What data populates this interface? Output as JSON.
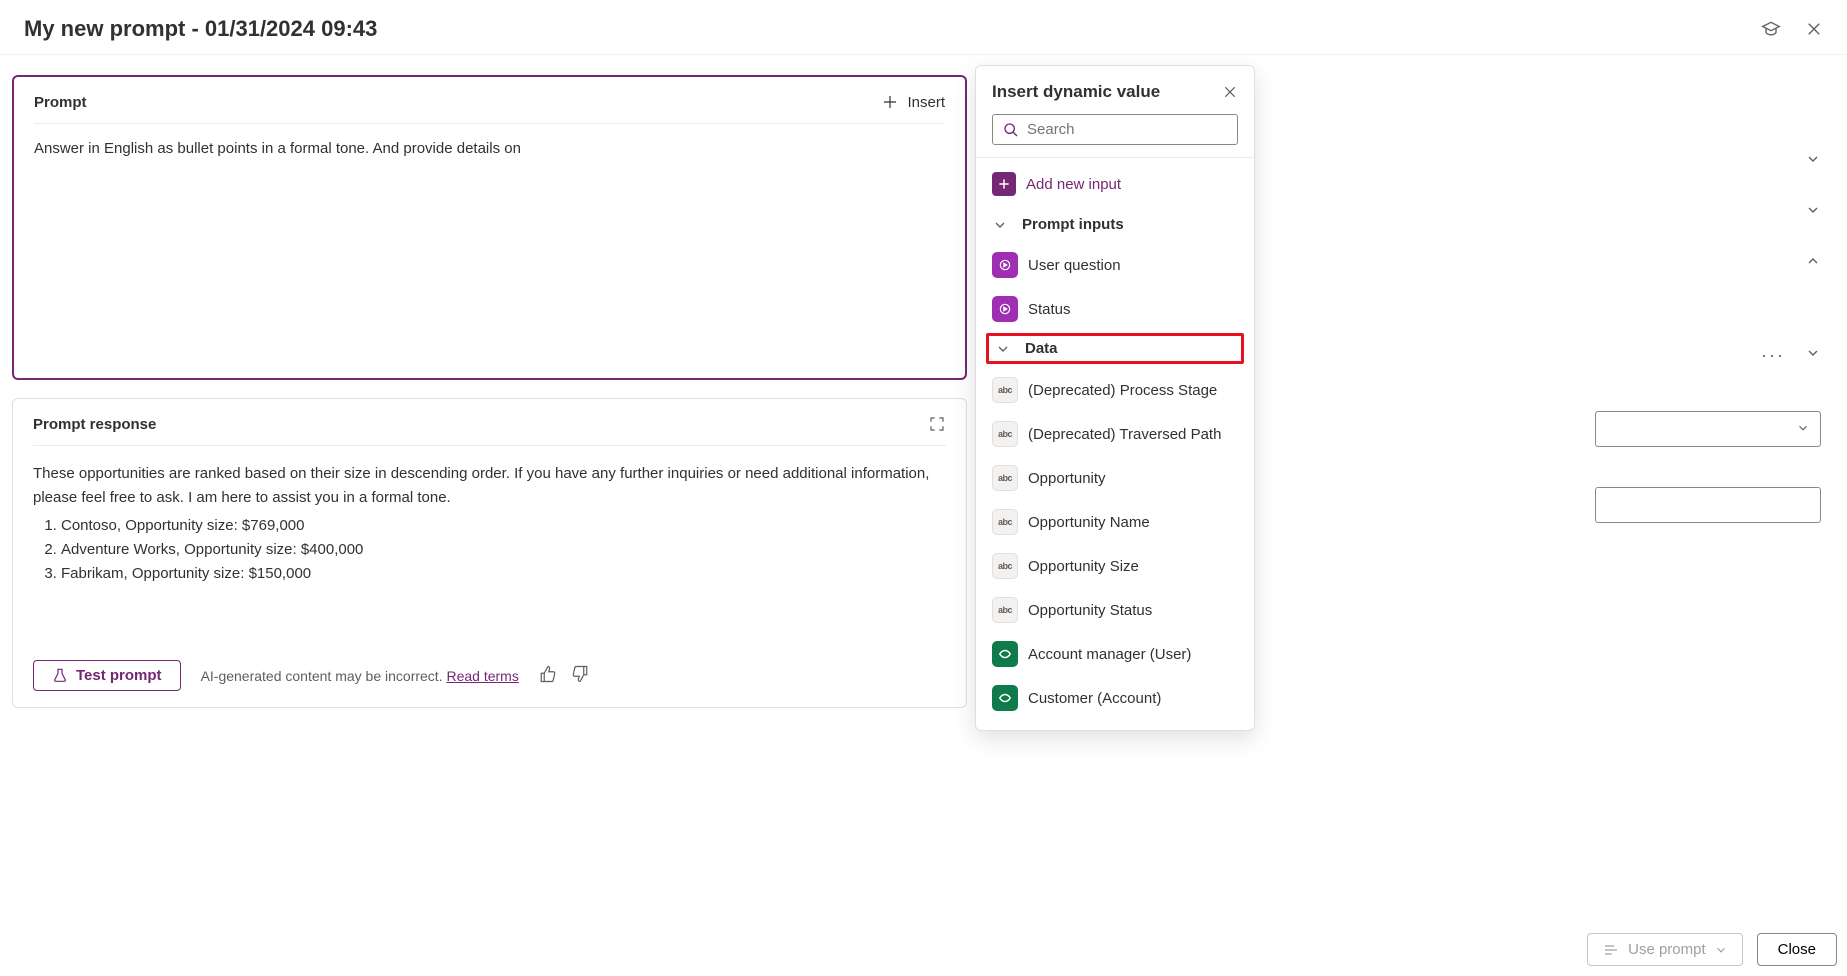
{
  "header": {
    "title": "My new prompt - 01/31/2024 09:43"
  },
  "prompt": {
    "section_label": "Prompt",
    "insert_label": "Insert",
    "text": "Answer in English as bullet points in a formal tone. And provide details on"
  },
  "response": {
    "section_label": "Prompt response",
    "intro": "These opportunities are ranked based on their size in descending order. If you have any further inquiries or need additional information, please feel free to ask. I am here to assist you in a formal tone.",
    "items": [
      "Contoso, Opportunity size: $769,000",
      "Adventure Works, Opportunity size: $400,000",
      "Fabrikam, Opportunity size: $150,000"
    ],
    "test_label": "Test prompt",
    "disclaimer": "AI-generated content may be incorrect.",
    "read_terms": "Read terms"
  },
  "flyout": {
    "title": "Insert dynamic value",
    "search_placeholder": "Search",
    "add_input_label": "Add new input",
    "sections": {
      "prompt_inputs": {
        "label": "Prompt inputs",
        "items": [
          {
            "label": "User question",
            "icon": "purple"
          },
          {
            "label": "Status",
            "icon": "purple"
          }
        ]
      },
      "data": {
        "label": "Data",
        "items": [
          {
            "label": "(Deprecated) Process Stage",
            "icon": "gray"
          },
          {
            "label": "(Deprecated) Traversed Path",
            "icon": "gray"
          },
          {
            "label": "Opportunity",
            "icon": "gray"
          },
          {
            "label": "Opportunity Name",
            "icon": "gray"
          },
          {
            "label": "Opportunity Size",
            "icon": "gray"
          },
          {
            "label": "Opportunity Status",
            "icon": "gray"
          },
          {
            "label": "Account manager (User)",
            "icon": "green"
          },
          {
            "label": "Customer (Account)",
            "icon": "green"
          }
        ]
      }
    }
  },
  "footer": {
    "use_prompt": "Use prompt",
    "close": "Close"
  }
}
